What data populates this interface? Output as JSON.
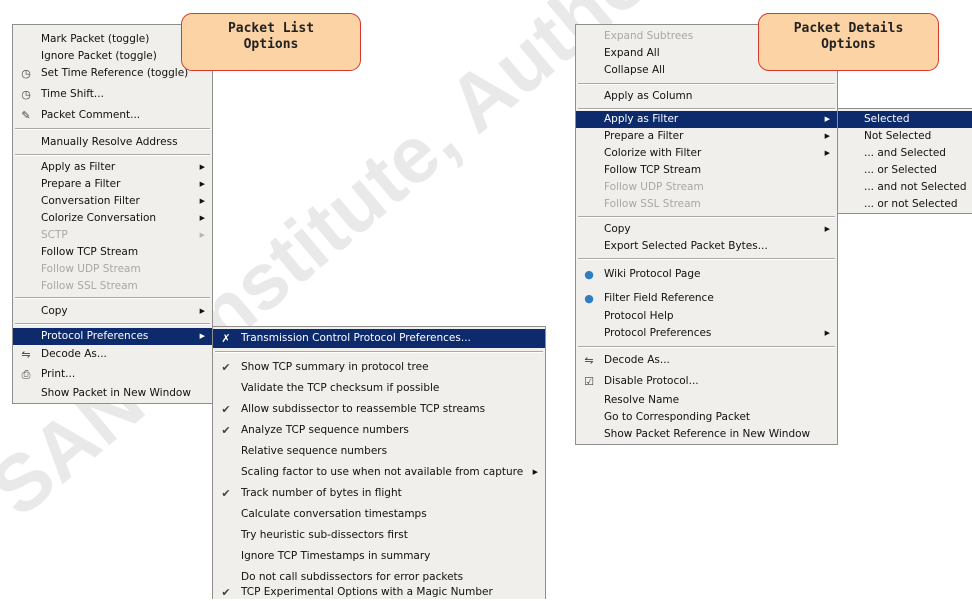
{
  "watermark": "SANS Institute, Author",
  "callouts": {
    "left": [
      "Packet List",
      "Options"
    ],
    "right": [
      "Packet Details",
      "Options"
    ]
  },
  "packet_list_menu": {
    "items": [
      {
        "label": "Mark Packet (toggle)",
        "icon": "",
        "disabled": false,
        "submenu": false
      },
      {
        "label": "Ignore Packet (toggle)",
        "icon": "",
        "disabled": false,
        "submenu": false
      },
      {
        "label": "Set Time Reference (toggle)",
        "icon": "clock-icon",
        "disabled": false,
        "submenu": false
      },
      {
        "label": "Time Shift...",
        "icon": "clock-icon",
        "disabled": false,
        "submenu": false
      },
      {
        "label": "Packet Comment...",
        "icon": "comment-icon",
        "disabled": false,
        "submenu": false
      },
      {
        "label": "Manually Resolve Address",
        "icon": "",
        "disabled": false,
        "submenu": false
      },
      {
        "label": "Apply as Filter",
        "icon": "",
        "disabled": false,
        "submenu": true
      },
      {
        "label": "Prepare a Filter",
        "icon": "",
        "disabled": false,
        "submenu": true
      },
      {
        "label": "Conversation Filter",
        "icon": "",
        "disabled": false,
        "submenu": true
      },
      {
        "label": "Colorize Conversation",
        "icon": "",
        "disabled": false,
        "submenu": true
      },
      {
        "label": "SCTP",
        "icon": "",
        "disabled": true,
        "submenu": true
      },
      {
        "label": "Follow TCP Stream",
        "icon": "",
        "disabled": false,
        "submenu": false
      },
      {
        "label": "Follow UDP Stream",
        "icon": "",
        "disabled": true,
        "submenu": false
      },
      {
        "label": "Follow SSL Stream",
        "icon": "",
        "disabled": true,
        "submenu": false
      },
      {
        "label": "Copy",
        "icon": "",
        "disabled": false,
        "submenu": true
      },
      {
        "label": "Protocol Preferences",
        "icon": "",
        "disabled": false,
        "submenu": true,
        "selected": true
      },
      {
        "label": "Decode As...",
        "icon": "decode-icon",
        "disabled": false,
        "submenu": false
      },
      {
        "label": "Print...",
        "icon": "printer-icon",
        "disabled": false,
        "submenu": false
      },
      {
        "label": "Show Packet in New Window",
        "icon": "",
        "disabled": false,
        "submenu": false
      }
    ]
  },
  "tcp_prefs_menu": {
    "items": [
      {
        "label": "Transmission Control Protocol Preferences...",
        "check": false,
        "icon": "wrench-icon",
        "selected": true
      },
      {
        "label": "Show TCP summary in protocol tree",
        "check": true
      },
      {
        "label": "Validate the TCP checksum if possible",
        "check": false
      },
      {
        "label": "Allow subdissector to reassemble TCP streams",
        "check": true
      },
      {
        "label": "Analyze TCP sequence numbers",
        "check": true
      },
      {
        "label": "Relative sequence numbers",
        "check": false
      },
      {
        "label": "Scaling factor to use when not available from capture",
        "check": false,
        "submenu": true
      },
      {
        "label": "Track number of bytes in flight",
        "check": true
      },
      {
        "label": "Calculate conversation timestamps",
        "check": false
      },
      {
        "label": "Try heuristic sub-dissectors first",
        "check": false
      },
      {
        "label": "Ignore TCP Timestamps in summary",
        "check": false
      },
      {
        "label": "Do not call subdissectors for error packets",
        "check": false
      },
      {
        "label": "TCP Experimental Options with a Magic Number",
        "check": true
      }
    ]
  },
  "packet_details_menu": {
    "items": [
      {
        "label": "Expand Subtrees",
        "disabled": true
      },
      {
        "label": "Expand All",
        "disabled": false
      },
      {
        "label": "Collapse All",
        "disabled": false
      },
      {
        "label": "Apply as Column",
        "disabled": false
      },
      {
        "label": "Apply as Filter",
        "disabled": false,
        "submenu": true,
        "selected": true
      },
      {
        "label": "Prepare a Filter",
        "disabled": false,
        "submenu": true
      },
      {
        "label": "Colorize with Filter",
        "disabled": false,
        "submenu": true
      },
      {
        "label": "Follow TCP Stream",
        "disabled": false
      },
      {
        "label": "Follow UDP Stream",
        "disabled": true
      },
      {
        "label": "Follow SSL Stream",
        "disabled": true
      },
      {
        "label": "Copy",
        "disabled": false,
        "submenu": true
      },
      {
        "label": "Export Selected Packet Bytes...",
        "disabled": false
      },
      {
        "label": "Wiki Protocol Page",
        "icon": "globe-icon",
        "disabled": false
      },
      {
        "label": "Filter Field Reference",
        "icon": "globe-icon",
        "disabled": false
      },
      {
        "label": "Protocol Help",
        "disabled": false
      },
      {
        "label": "Protocol Preferences",
        "disabled": false,
        "submenu": true
      },
      {
        "label": "Decode As...",
        "icon": "decode-icon",
        "disabled": false
      },
      {
        "label": "Disable Protocol...",
        "icon": "checkbox-icon",
        "disabled": false
      },
      {
        "label": "Resolve Name",
        "disabled": false
      },
      {
        "label": "Go to Corresponding Packet",
        "disabled": false
      },
      {
        "label": "Show Packet Reference in New Window",
        "disabled": false
      }
    ]
  },
  "apply_filter_submenu": {
    "items": [
      {
        "label": "Selected",
        "selected": true
      },
      {
        "label": "Not Selected"
      },
      {
        "label": "... and Selected"
      },
      {
        "label": "... or Selected"
      },
      {
        "label": "... and not Selected"
      },
      {
        "label": "... or not Selected"
      }
    ]
  }
}
